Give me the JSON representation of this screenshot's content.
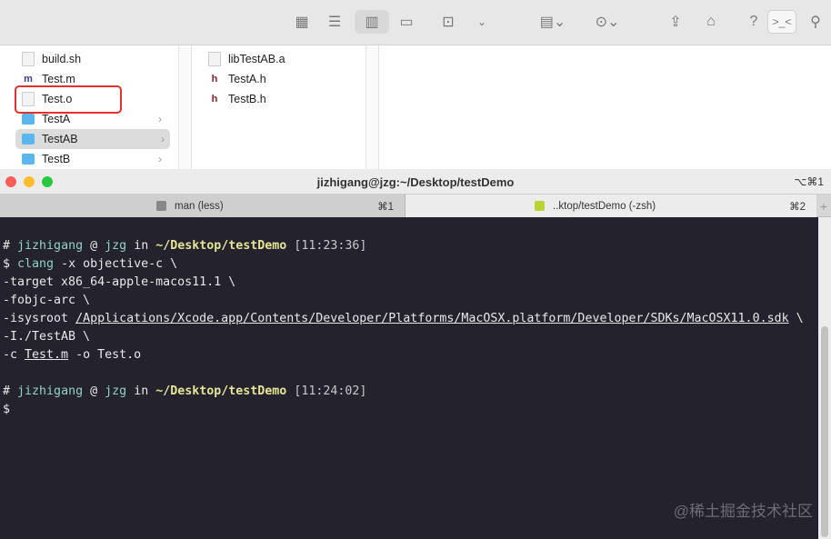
{
  "finder": {
    "column1": [
      {
        "name": "build.sh",
        "type": "file"
      },
      {
        "name": "Test.m",
        "type": "m"
      },
      {
        "name": "Test.o",
        "type": "file",
        "highlighted": true
      },
      {
        "name": "TestA",
        "type": "folder"
      },
      {
        "name": "TestAB",
        "type": "folder",
        "selected": true
      },
      {
        "name": "TestB",
        "type": "folder"
      }
    ],
    "column2": [
      {
        "name": "libTestAB.a",
        "type": "file"
      },
      {
        "name": "TestA.h",
        "type": "h"
      },
      {
        "name": "TestB.h",
        "type": "h"
      }
    ],
    "icons": {
      "m": "m",
      "h": "h",
      "chevron": "›"
    }
  },
  "terminal": {
    "title": "jizhigang@jzg:~/Desktop/testDemo",
    "shortcut": "⌥⌘1",
    "tabs": [
      {
        "label": "man (less)",
        "shortcut": "⌘1"
      },
      {
        "label": "..ktop/testDemo (-zsh)",
        "shortcut": "⌘2"
      }
    ],
    "new_tab": "+",
    "prompt1": {
      "hash": "#",
      "user": "jizhigang",
      "at": "@",
      "host": "jzg",
      "in": "in",
      "path": "~/Desktop/testDemo",
      "time": "[11:23:36]"
    },
    "cmd": {
      "dollar": "$",
      "clang": "clang",
      "rest": " -x objective-c \\"
    },
    "lines": [
      "-target x86_64-apple-macos11.1 \\",
      "-fobjc-arc \\"
    ],
    "isysroot": {
      "flag": "-isysroot ",
      "path": "/Applications/Xcode.app/Contents/Developer/Platforms/MacOSX.platform/Developer/SDKs/MacOSX11.0.sdk",
      "end": " \\"
    },
    "include_line": "-I./TestAB \\",
    "compile": {
      "flag": "-c ",
      "src": "Test.m",
      "rest": " -o Test.o"
    },
    "prompt2": {
      "hash": "#",
      "user": "jizhigang",
      "at": "@",
      "host": "jzg",
      "in": "in",
      "path": "~/Desktop/testDemo",
      "time": "[11:24:02]"
    },
    "prompt_dollar": "$"
  },
  "toolbar": {
    "help": "?",
    "terminal_icon": ">_<"
  },
  "watermark": "@稀土掘金技术社区"
}
